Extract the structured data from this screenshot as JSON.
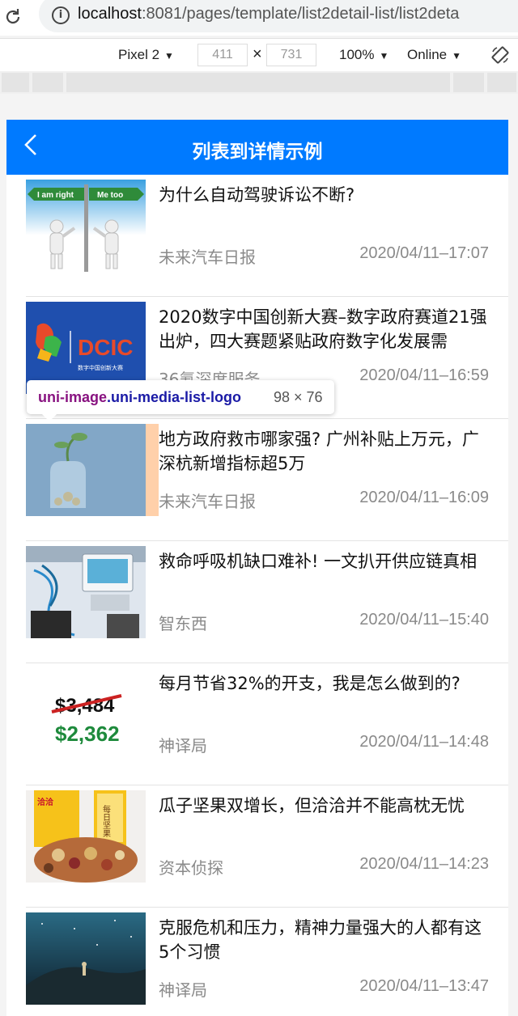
{
  "browser": {
    "url_host": "localhost",
    "url_rest": ":8081/pages/template/list2detail-list/list2deta",
    "device": "Pixel 2",
    "width": "411",
    "height": "731",
    "times": "×",
    "zoom": "100%",
    "network": "Online"
  },
  "app": {
    "title": "列表到详情示例"
  },
  "inspector_tooltip": {
    "tag": "uni-image",
    "classes": ".uni-media-list-logo",
    "size": "98 × 76"
  },
  "news": [
    {
      "title": "为什么自动驾驶诉讼不断?",
      "source": "未来汽车日报",
      "time": "2020/04/11–17:07",
      "thumb": "road-sign-figures"
    },
    {
      "title": "2020数字中国创新大赛–数字政府赛道21强出炉，四大赛题紧贴政府数字化发展需",
      "source": "36氪深度服务",
      "time": "2020/04/11–16:59",
      "thumb": "dcic-logo"
    },
    {
      "title": "地方政府救市哪家强? 广州补贴上万元，广深杭新增指标超5万",
      "source": "未来汽车日报",
      "time": "2020/04/11–16:09",
      "thumb": "plant-jar"
    },
    {
      "title": "救命呼吸机缺口难补! 一文扒开供应链真相",
      "source": "智东西",
      "time": "2020/04/11–15:40",
      "thumb": "ventilator"
    },
    {
      "title": "每月节省32%的开支，我是怎么做到的?",
      "source": "神译局",
      "time": "2020/04/11–14:48",
      "thumb": "price-tag"
    },
    {
      "title": "瓜子坚果双增长，但洽洽并不能高枕无忧",
      "source": "资本侦探",
      "time": "2020/04/11–14:23",
      "thumb": "nut-snack"
    },
    {
      "title": "克服危机和压力，精神力量强大的人都有这5个习惯",
      "source": "神译局",
      "time": "2020/04/11–13:47",
      "thumb": "night-sky-person"
    }
  ],
  "thumb_text": {
    "sign_left": "I am right",
    "sign_right": "Me too",
    "dcic": "DCIC",
    "dcic_sub": "数字中国创新大赛",
    "price_old": "$3,484",
    "price_new": "$2,362",
    "snack_brand": "洽洽",
    "snack_label": "每日坚果"
  },
  "colors": {
    "nav_bg": "#007aff",
    "title_text": "#111111",
    "meta_text": "#8a8a8a",
    "price_old": "#cc2222",
    "price_new": "#1e8a3c"
  }
}
